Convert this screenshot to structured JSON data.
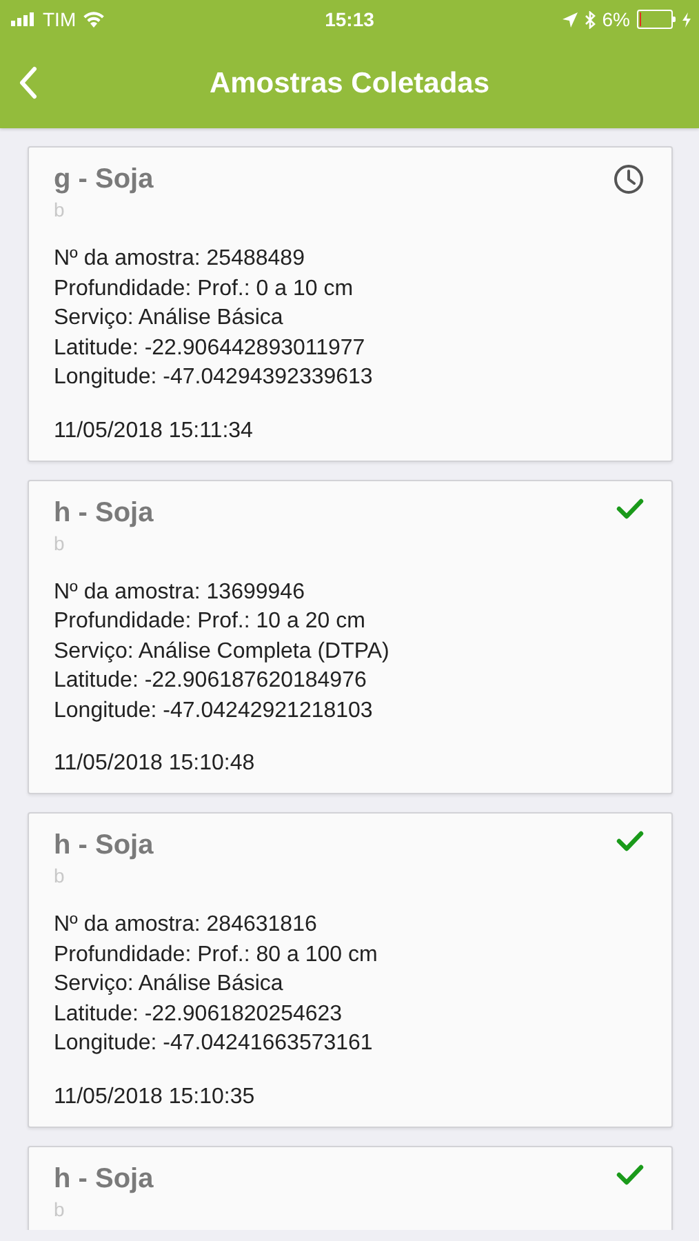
{
  "status_bar": {
    "carrier": "TIM",
    "time": "15:13",
    "battery_text": "6%",
    "battery": {
      "level": 0.06
    }
  },
  "header": {
    "title": "Amostras Coletadas"
  },
  "samples": [
    {
      "title": "g - Soja",
      "subtitle": "b",
      "synced": false,
      "lines": [
        "Nº da amostra: 25488489",
        "Profundidade: Prof.: 0 a 10 cm",
        "Serviço: Análise Básica",
        "Latitude: -22.906442893011977",
        "Longitude: -47.04294392339613"
      ],
      "date": "11/05/2018 15:11:34"
    },
    {
      "title": "h - Soja",
      "subtitle": "b",
      "synced": true,
      "lines": [
        "Nº da amostra: 13699946",
        "Profundidade: Prof.: 10 a 20 cm",
        "Serviço: Análise Completa (DTPA)",
        "Latitude: -22.906187620184976",
        "Longitude: -47.04242921218103"
      ],
      "date": "11/05/2018 15:10:48"
    },
    {
      "title": "h - Soja",
      "subtitle": "b",
      "synced": true,
      "lines": [
        "Nº da amostra: 284631816",
        "Profundidade: Prof.: 80 a 100 cm",
        "Serviço: Análise Básica",
        "Latitude: -22.9061820254623",
        "Longitude: -47.04241663573161"
      ],
      "date": "11/05/2018 15:10:35"
    },
    {
      "title": "h - Soja",
      "subtitle": "b",
      "synced": true
    }
  ]
}
